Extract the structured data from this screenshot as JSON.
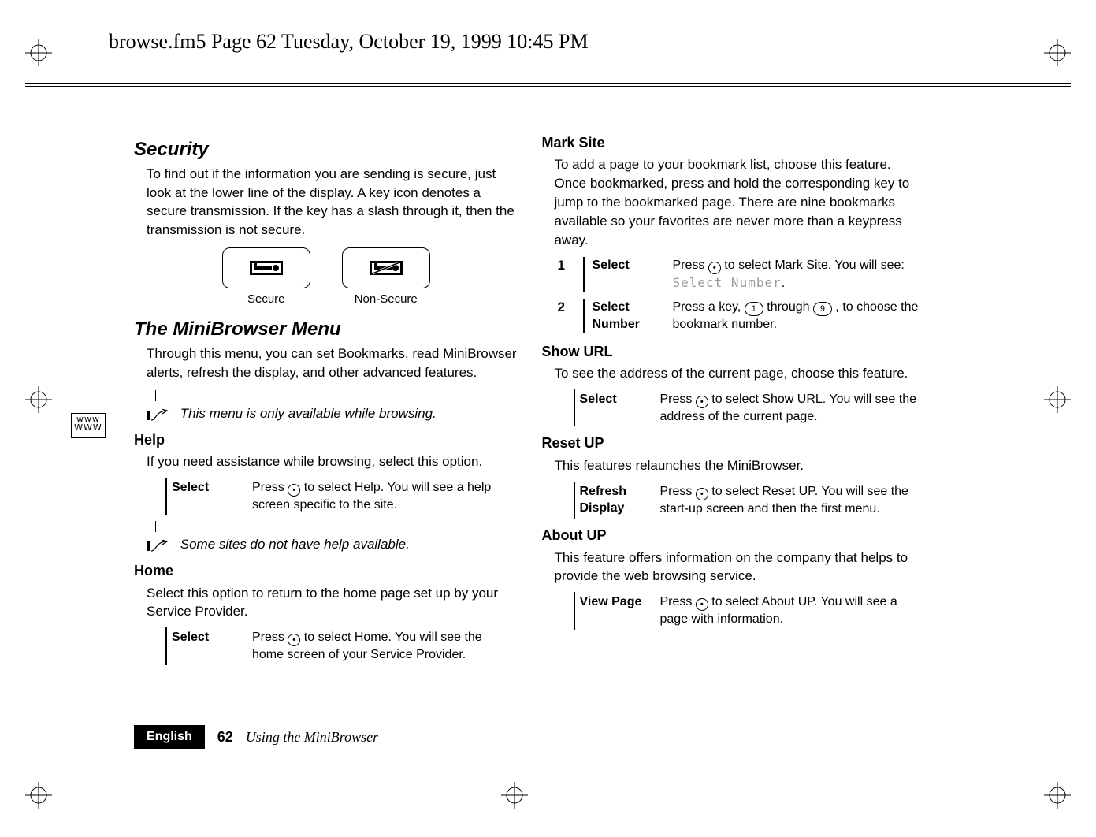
{
  "header": "browse.fm5  Page 62  Tuesday, October 19, 1999  10:45 PM",
  "left": {
    "security_title": "Security",
    "security_body": "To find out if the information you are sending is secure, just look at the lower line of the display. A key icon denotes a secure transmission. If the key has a slash through it, then the transmission is not secure.",
    "secure_label": "Secure",
    "nonsecure_label": "Non-Secure",
    "menu_title": "The MiniBrowser Menu",
    "menu_body": "Through this menu, you can set Bookmarks, read MiniBrowser alerts, refresh the display, and other advanced features.",
    "menu_note": "This menu is only available while browsing.",
    "help_head": "Help",
    "help_body": "If you need assistance while browsing, select this option.",
    "help_select_label": "Select",
    "help_select_pre": "Press ",
    "help_select_post": " to select Help. You will see a help screen specific to the site.",
    "help_note": "Some sites do not have help available.",
    "home_head": "Home",
    "home_body": "Select this option to return to the home page set up by your Service Provider.",
    "home_select_label": "Select",
    "home_select_pre": "Press ",
    "home_select_post": " to select Home. You will see the home screen of your Service Provider."
  },
  "right": {
    "mark_head": "Mark Site",
    "mark_body": "To add a page to your bookmark list, choose this feature. Once bookmarked, press and hold the corresponding key to jump to the bookmarked page. There are nine bookmarks available so your favorites are never more than a keypress away.",
    "mark_row1_num": "1",
    "mark_row1_label": "Select",
    "mark_row1_pre": "Press ",
    "mark_row1_mid": " to select Mark Site. You will see: ",
    "mark_row1_lcd": "Select Number",
    "mark_row1_end": ".",
    "mark_row2_num": "2",
    "mark_row2_label": "Select Number",
    "mark_row2_pre": "Press a key, ",
    "mark_row2_key1": "1",
    "mark_row2_mid": " through ",
    "mark_row2_key9": "9",
    "mark_row2_post": ", to choose the bookmark number.",
    "show_head": "Show URL",
    "show_body": "To see the address of the current page, choose this feature.",
    "show_label": "Select",
    "show_pre": "Press ",
    "show_post": " to select Show URL. You will see the address of the current page.",
    "reset_head": "Reset UP",
    "reset_body": "This features relaunches the MiniBrowser.",
    "reset_label": "Refresh Display",
    "reset_pre": "Press ",
    "reset_post": " to select Reset UP. You will see the start-up screen and then the first menu.",
    "about_head": "About UP",
    "about_body": "This feature offers information on the company that helps to provide the web browsing service.",
    "about_label": "View Page",
    "about_pre": "Press ",
    "about_post": " to select About UP. You will see a page with information."
  },
  "footer": {
    "language": "English",
    "page": "62",
    "title": "Using the MiniBrowser"
  },
  "side_www_top": "www",
  "side_www_bot": "WWW",
  "press_glyph_char": "•"
}
